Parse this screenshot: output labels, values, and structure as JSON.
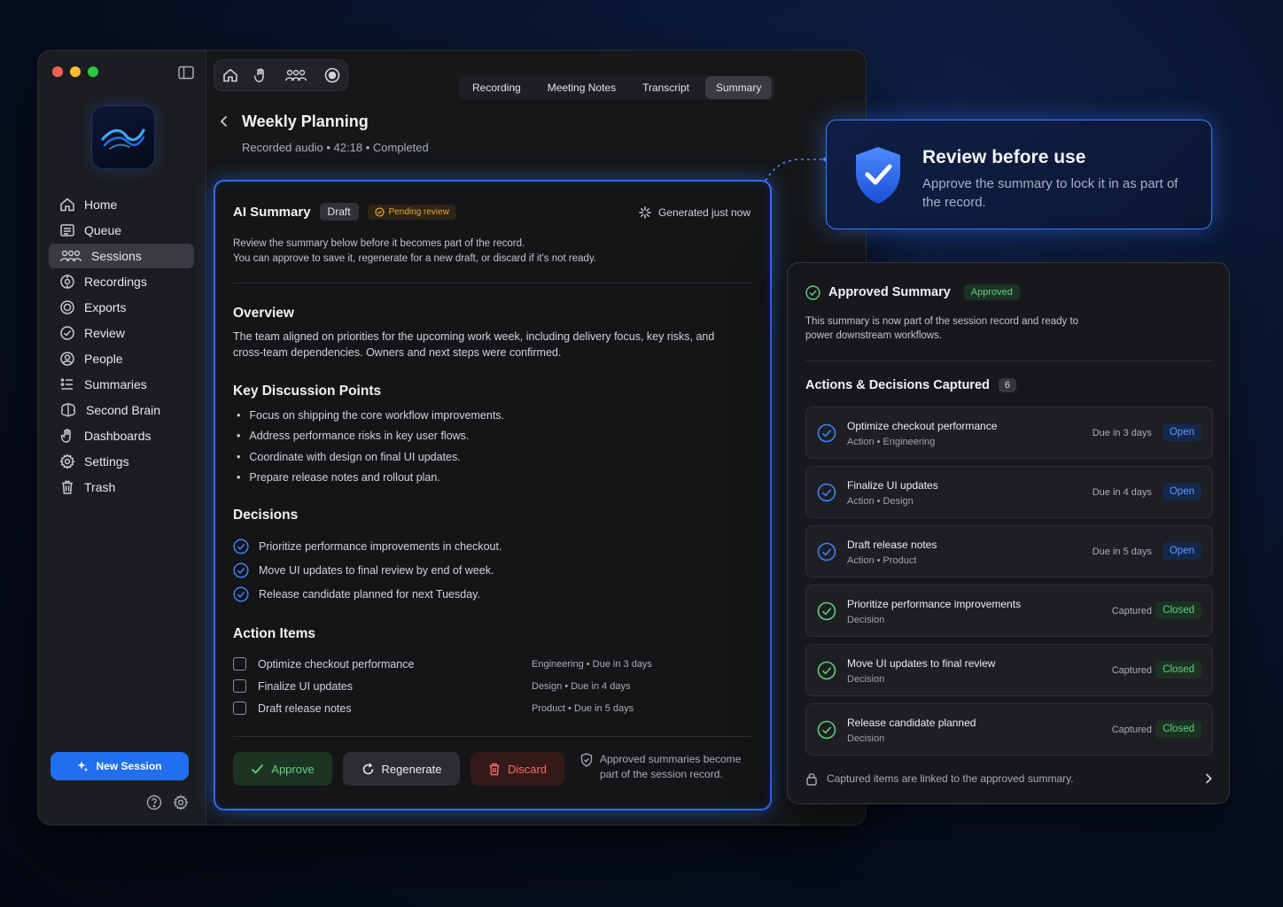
{
  "sidebar": {
    "items": [
      {
        "label": "Home",
        "icon": "home-icon"
      },
      {
        "label": "Queue",
        "icon": "queue-icon"
      },
      {
        "label": "Sessions",
        "icon": "people-group-icon",
        "active": true
      },
      {
        "label": "Recordings",
        "icon": "recordings-icon"
      },
      {
        "label": "Exports",
        "icon": "exports-icon"
      },
      {
        "label": "Review",
        "icon": "check-circle-icon"
      },
      {
        "label": "People",
        "icon": "person-icon"
      },
      {
        "label": "Summaries",
        "icon": "list-icon"
      },
      {
        "label": "Second Brain",
        "icon": "brain-icon"
      },
      {
        "label": "Dashboards",
        "icon": "hand-icon"
      },
      {
        "label": "Settings",
        "icon": "gear-icon"
      },
      {
        "label": "Trash",
        "icon": "trash-icon"
      }
    ],
    "new_session_label": "New Session"
  },
  "tabs": [
    {
      "label": "Recording",
      "active": false
    },
    {
      "label": "Meeting Notes",
      "active": false
    },
    {
      "label": "Transcript",
      "active": false
    },
    {
      "label": "Summary",
      "active": true
    }
  ],
  "page": {
    "title": "Weekly Planning",
    "subtitle": "Recorded audio • 42:18 • Completed"
  },
  "summary_card": {
    "title": "AI Summary",
    "badge_draft": "Draft",
    "badge_pending": "Pending review",
    "generated": "Generated just now",
    "intro_line1": "Review the summary below before it becomes part of the record.",
    "intro_line2": "You can approve to save it, regenerate for a new draft, or discard if it's not ready.",
    "overview_heading": "Overview",
    "overview_text": "The team aligned on priorities for the upcoming work week, including delivery focus, key risks, and cross-team dependencies. Owners and next steps were confirmed.",
    "key_points_heading": "Key Discussion Points",
    "key_points": [
      "Focus on shipping the core workflow improvements.",
      "Address performance risks in key user flows.",
      "Coordinate with design on final UI updates.",
      "Prepare release notes and rollout plan."
    ],
    "decisions_heading": "Decisions",
    "decisions": [
      "Prioritize performance improvements in checkout.",
      "Move UI updates to final review by end of week.",
      "Release candidate planned for next Tuesday."
    ],
    "action_items_heading": "Action Items",
    "action_items": [
      {
        "label": "Optimize checkout performance",
        "meta": "Engineering • Due in 3 days"
      },
      {
        "label": "Finalize UI updates",
        "meta": "Design • Due in 4 days"
      },
      {
        "label": "Draft release notes",
        "meta": "Product • Due in 5 days"
      }
    ],
    "approve_label": "Approve",
    "regenerate_label": "Regenerate",
    "discard_label": "Discard",
    "footnote": "Approved summaries become part of the session record."
  },
  "callout": {
    "title": "Review before use",
    "text": "Approve the summary to lock it in as part of the record."
  },
  "approved_panel": {
    "title": "Approved Summary",
    "badge": "Approved",
    "intro": "This summary is now part of the session record and ready to power downstream workflows.",
    "captured_heading": "Actions & Decisions Captured",
    "captured_count": "6",
    "items": [
      {
        "title": "Optimize checkout performance",
        "sub": "Action • Engineering",
        "due": "Due in 3 days",
        "status": "Open"
      },
      {
        "title": "Finalize UI updates",
        "sub": "Action • Design",
        "due": "Due in 4 days",
        "status": "Open"
      },
      {
        "title": "Draft release notes",
        "sub": "Action • Product",
        "due": "Due in 5 days",
        "status": "Open"
      },
      {
        "title": "Prioritize performance improvements",
        "sub": "Decision",
        "due": "Captured",
        "status": "Closed"
      },
      {
        "title": "Move UI updates to final review",
        "sub": "Decision",
        "due": "Captured",
        "status": "Closed"
      },
      {
        "title": "Release candidate planned",
        "sub": "Decision",
        "due": "Captured",
        "status": "Closed"
      }
    ],
    "footer": "Captured items are linked to the approved summary."
  },
  "colors": {
    "accent_blue": "#2f6dff",
    "approve_green": "#5fcf7c",
    "discard_red": "#ff6b66",
    "pending_orange": "#e7a83a"
  }
}
